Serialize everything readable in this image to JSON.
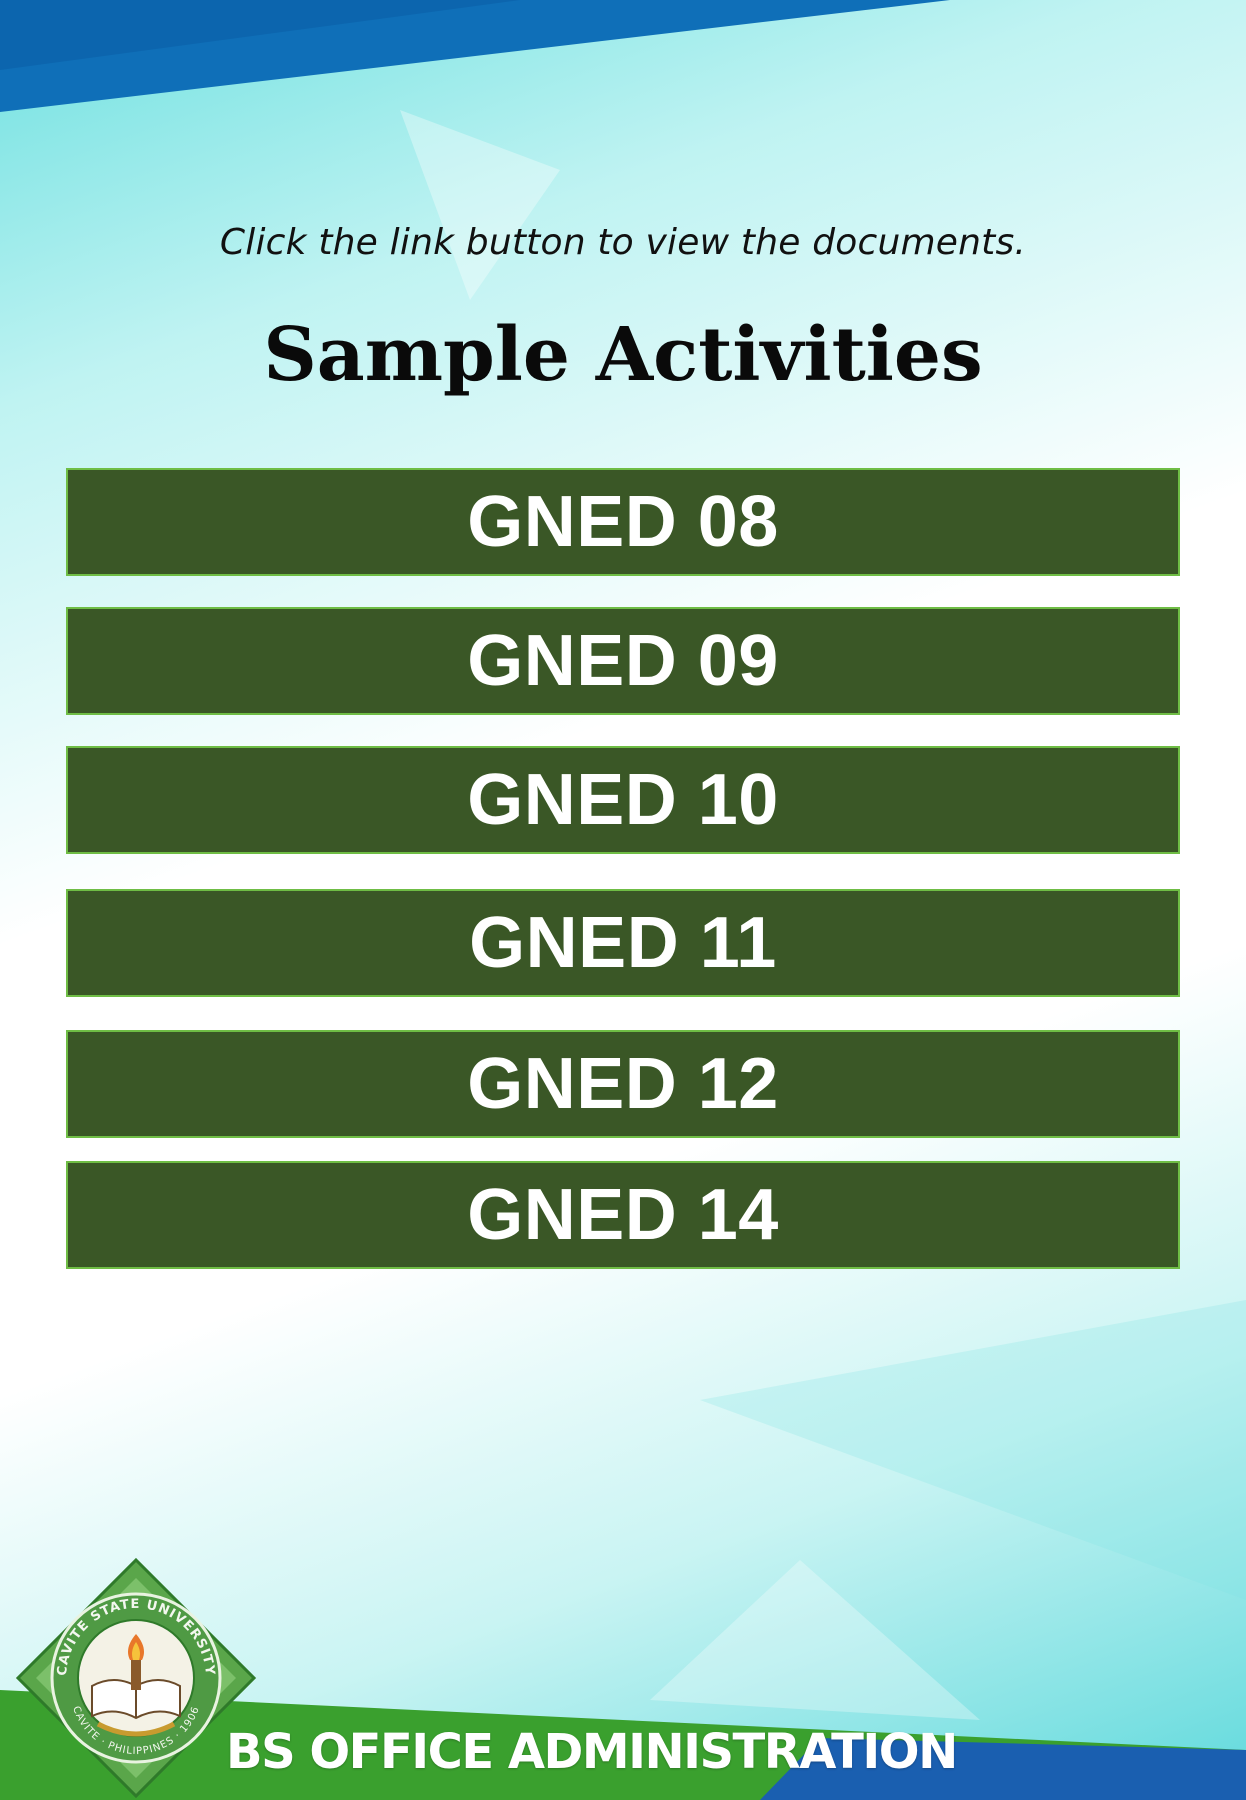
{
  "instruction_text": "Click the link button to view the documents.",
  "page_title": "Sample Activities",
  "courses": [
    {
      "label": "GNED 08"
    },
    {
      "label": "GNED 09"
    },
    {
      "label": "GNED 10"
    },
    {
      "label": "GNED 11"
    },
    {
      "label": "GNED 12"
    },
    {
      "label": "GNED 14"
    }
  ],
  "footer": {
    "program_name": "BS OFFICE ADMINISTRATION",
    "logo": {
      "icon": "university-seal-icon",
      "ring_text_top": "CAVITE STATE UNIVERSITY",
      "ring_text_bottom": "CAVITE · PHILIPPINES · 1906"
    }
  },
  "colors": {
    "button_fill": "#3a5726",
    "button_border": "#6fbd45",
    "banner_blue": "#0f6fb8",
    "footer_green": "#3aa02e"
  }
}
